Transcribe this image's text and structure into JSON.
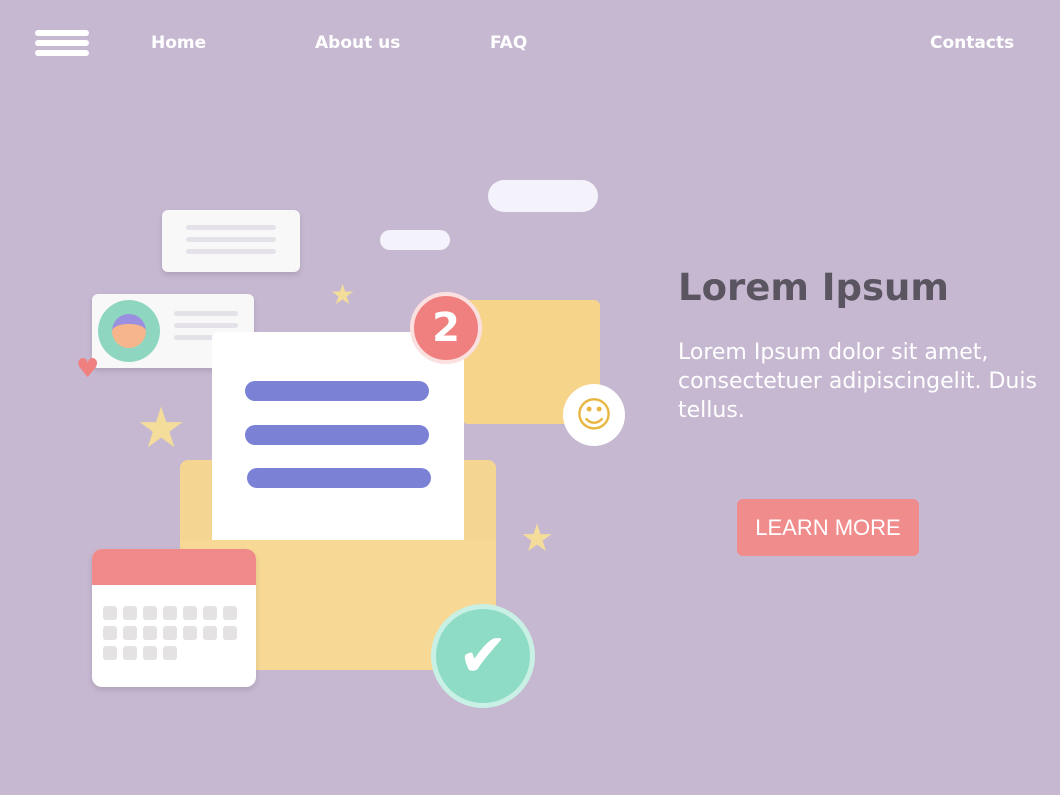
{
  "nav": {
    "home": "Home",
    "about": "About us",
    "faq": "FAQ",
    "contacts": "Contacts"
  },
  "hero": {
    "title": "Lorem Ipsum",
    "description": "Lorem Ipsum dolor sit amet, consectetuer adipiscingelit. Duis tellus.",
    "button": "LEARN MORE"
  },
  "illustration": {
    "badge_count": "2"
  },
  "colors": {
    "background": "#c6b8d1",
    "button": "#f08c8c",
    "title": "#5a5560"
  }
}
